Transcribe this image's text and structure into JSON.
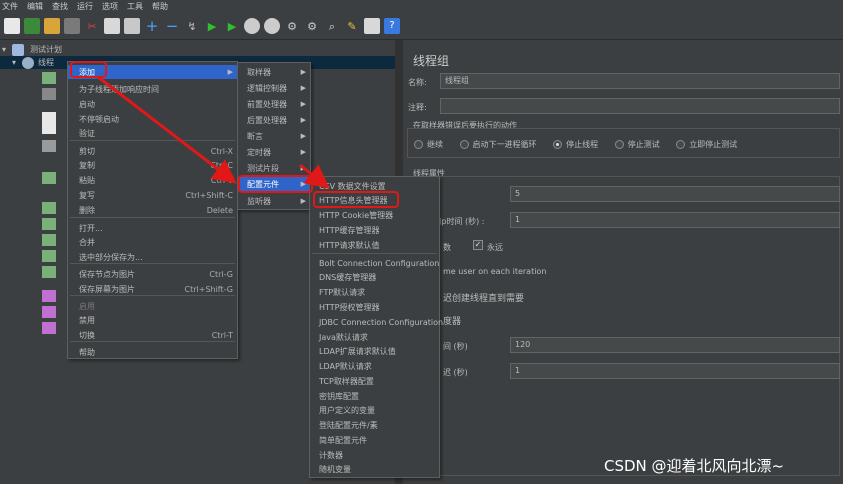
{
  "menubar": [
    "文件",
    "编辑",
    "查找",
    "运行",
    "选项",
    "工具",
    "帮助"
  ],
  "tree": {
    "root": "测试计划",
    "thread_group": "线程"
  },
  "context_menu": {
    "items": [
      {
        "label": "添加",
        "shortcut": "",
        "submenu": true,
        "highlighted": true
      },
      {
        "label": "为子线程添加响应时间",
        "shortcut": ""
      },
      {
        "label": "启动",
        "shortcut": ""
      },
      {
        "label": "不停顿启动",
        "shortcut": ""
      },
      {
        "label": "验证",
        "shortcut": ""
      },
      {
        "label": "剪切",
        "shortcut": "Ctrl-X"
      },
      {
        "label": "复制",
        "shortcut": "Ctrl-C"
      },
      {
        "label": "粘贴",
        "shortcut": "Ctrl-V"
      },
      {
        "label": "复写",
        "shortcut": "Ctrl+Shift-C"
      },
      {
        "label": "删除",
        "shortcut": "Delete"
      },
      {
        "label": "打开...",
        "shortcut": ""
      },
      {
        "label": "合并",
        "shortcut": ""
      },
      {
        "label": "选中部分保存为...",
        "shortcut": ""
      },
      {
        "label": "保存节点为图片",
        "shortcut": "Ctrl-G"
      },
      {
        "label": "保存屏幕为图片",
        "shortcut": "Ctrl+Shift-G"
      },
      {
        "label": "启用",
        "shortcut": "",
        "disabled": true
      },
      {
        "label": "禁用",
        "shortcut": ""
      },
      {
        "label": "切换",
        "shortcut": "Ctrl-T"
      },
      {
        "label": "帮助",
        "shortcut": ""
      }
    ]
  },
  "add_submenu": {
    "items": [
      "取样器",
      "逻辑控制器",
      "前置处理器",
      "后置处理器",
      "断言",
      "定时器",
      "测试片段",
      "配置元件",
      "监听器"
    ],
    "highlighted": "配置元件"
  },
  "config_submenu": {
    "items": [
      "CSV 数据文件设置",
      "HTTP信息头管理器",
      "HTTP Cookie管理器",
      "HTTP缓存管理器",
      "HTTP请求默认值",
      "Bolt Connection Configuration",
      "DNS缓存管理器",
      "FTP默认请求",
      "HTTP授权管理器",
      "JDBC Connection Configuration",
      "Java默认请求",
      "LDAP扩展请求默认值",
      "LDAP默认请求",
      "TCP取样器配置",
      "密钥库配置",
      "用户定义的变量",
      "登陆配置元件/素",
      "简单配置元件",
      "计数器",
      "随机变量"
    ],
    "boxed": "HTTP信息头管理器"
  },
  "panel": {
    "title": "线程组",
    "name_label": "名称:",
    "name_value": "线程组",
    "comment_label": "注释:",
    "comment_value": "",
    "error_action_title": "在取样器错误后要执行的动作",
    "error_actions": [
      {
        "label": "继续",
        "checked": false
      },
      {
        "label": "启动下一进程循环",
        "checked": false
      },
      {
        "label": "停止线程",
        "checked": true
      },
      {
        "label": "停止测试",
        "checked": false
      },
      {
        "label": "立即停止测试",
        "checked": false
      }
    ],
    "thread_props_title": "线程属性",
    "num_threads_value": "5",
    "rampup_label": "Jp时间 (秒) :",
    "rampup_value": "1",
    "loop_partial": "数",
    "forever_label": "永远",
    "forever_checked": true,
    "same_user_partial": "me user on each iteration",
    "delay_partial": "迟创建线程直到需要",
    "scheduler_partial": "度器",
    "duration_partial": "间 (秒)",
    "duration_value": "120",
    "startup_partial": "迟 (秒)",
    "startup_value": "1"
  },
  "watermark": "CSDN @迎着北风向北漂~",
  "colors": {
    "background": "#3c3f41",
    "selection": "#2f65ca",
    "annotation_red": "#e01818"
  }
}
